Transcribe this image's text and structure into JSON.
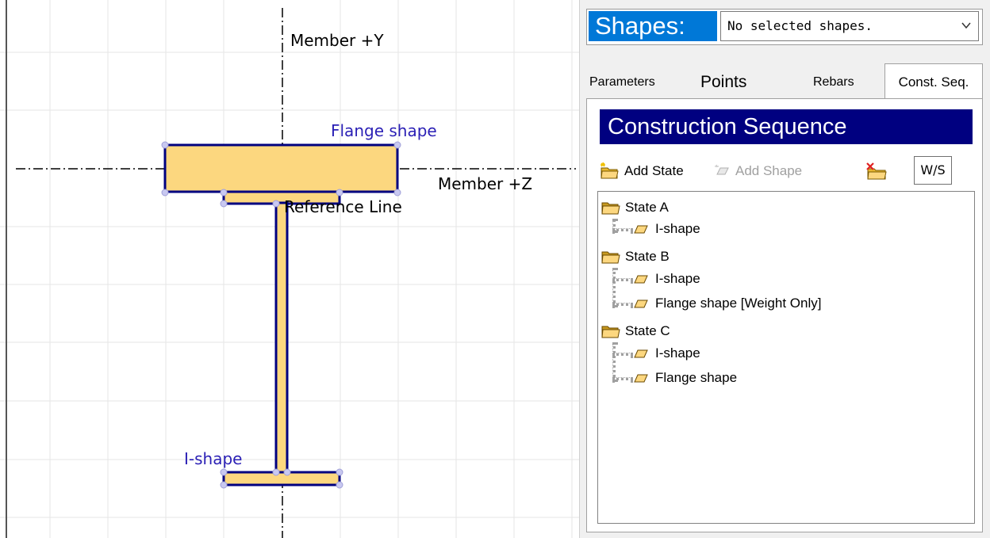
{
  "canvas": {
    "axis_y_label": "Member +Y",
    "axis_z_label": "Member +Z",
    "reference_line_label": "Reference Line",
    "flange_label": "Flange shape",
    "ishape_label": "I-shape",
    "colors": {
      "fill": "#fcd77f",
      "outline": "#000080",
      "label_blue": "#2a1fb5",
      "grid": "#e6e6e6",
      "handle": "#c8c8f0"
    }
  },
  "panel": {
    "shapes_label": "Shapes:",
    "shapes_select_value": "No selected shapes.",
    "tabs": [
      {
        "label": "Parameters"
      },
      {
        "label": "Points"
      },
      {
        "label": "Rebars"
      },
      {
        "label": "Const. Seq.",
        "active": true
      }
    ],
    "construction_title": "Construction Sequence",
    "toolbar": {
      "add_state": "Add State",
      "add_shape": "Add Shape",
      "ws": "W/S"
    },
    "tree": [
      {
        "label": "State A",
        "children": [
          "I-shape"
        ]
      },
      {
        "label": "State B",
        "children": [
          "I-shape",
          "Flange shape [Weight Only]"
        ]
      },
      {
        "label": "State C",
        "children": [
          "I-shape",
          "Flange shape"
        ]
      }
    ]
  }
}
